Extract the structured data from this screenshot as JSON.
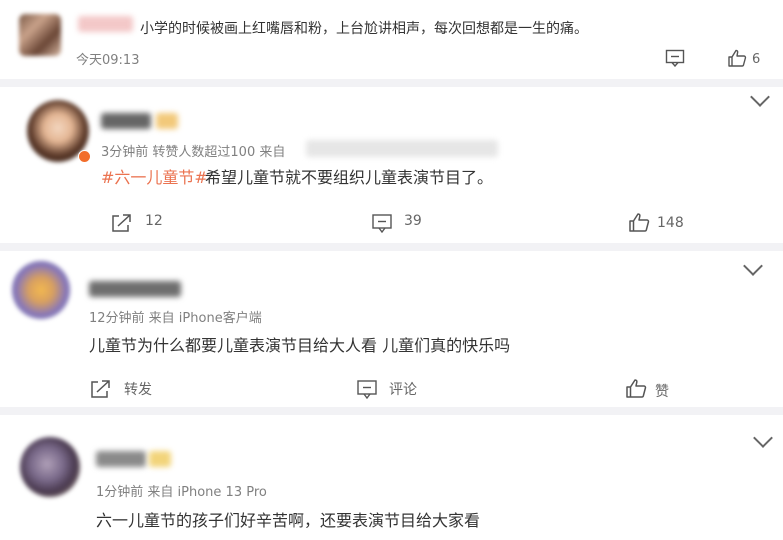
{
  "comment0": {
    "text": "小学的时候被画上红嘴唇和粉，上台尬讲相声，每次回想都是一生的痛。",
    "time": "今天09:13",
    "like_count": "6"
  },
  "post1": {
    "meta_left": "3分钟前  转赞人数超过100  来自",
    "hashtag": "#六一儿童节#",
    "body": "希望儿童节就不要组织儿童表演节目了。",
    "repost_count": "12",
    "comment_count": "39",
    "like_count": "148"
  },
  "post2": {
    "meta": "12分钟前  来自 iPhone客户端",
    "body": "儿童节为什么都要儿童表演节目给大人看 儿童们真的快乐吗",
    "repost_label": "转发",
    "comment_label": "评论",
    "like_label": "赞"
  },
  "post3": {
    "meta": "1分钟前  来自 iPhone 13 Pro",
    "body": "六一儿童节的孩子们好辛苦啊，还要表演节目给大家看"
  },
  "colors": {
    "accent": "#eb7350",
    "bg_divider": "#f2f2f5",
    "text_main": "#333333",
    "text_meta": "#808080"
  }
}
